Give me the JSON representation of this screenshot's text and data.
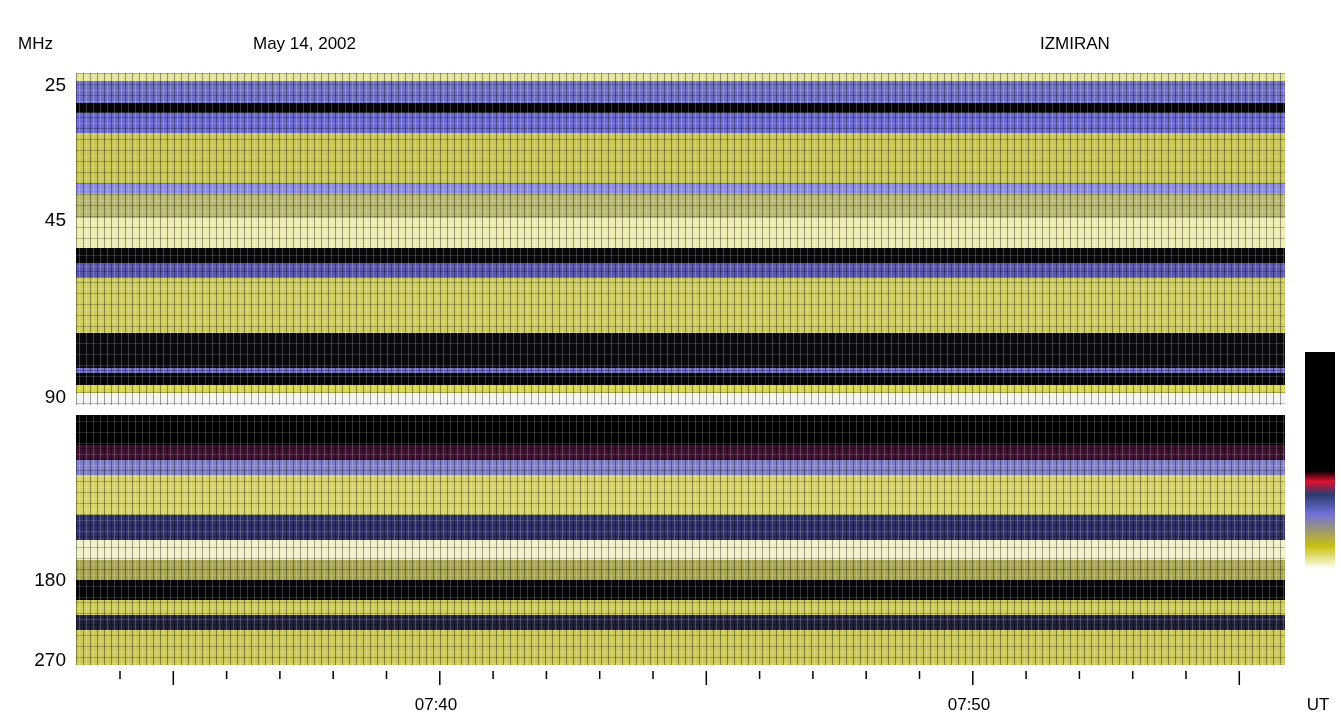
{
  "y_axis": {
    "unit": "MHz",
    "labels": [
      "25",
      "45",
      "90",
      "180",
      "270"
    ]
  },
  "title": "May 14, 2002",
  "observatory": "IZMIRAN",
  "x_axis": {
    "labels": [
      "07:40",
      "07:50"
    ],
    "unit": "UT"
  }
}
